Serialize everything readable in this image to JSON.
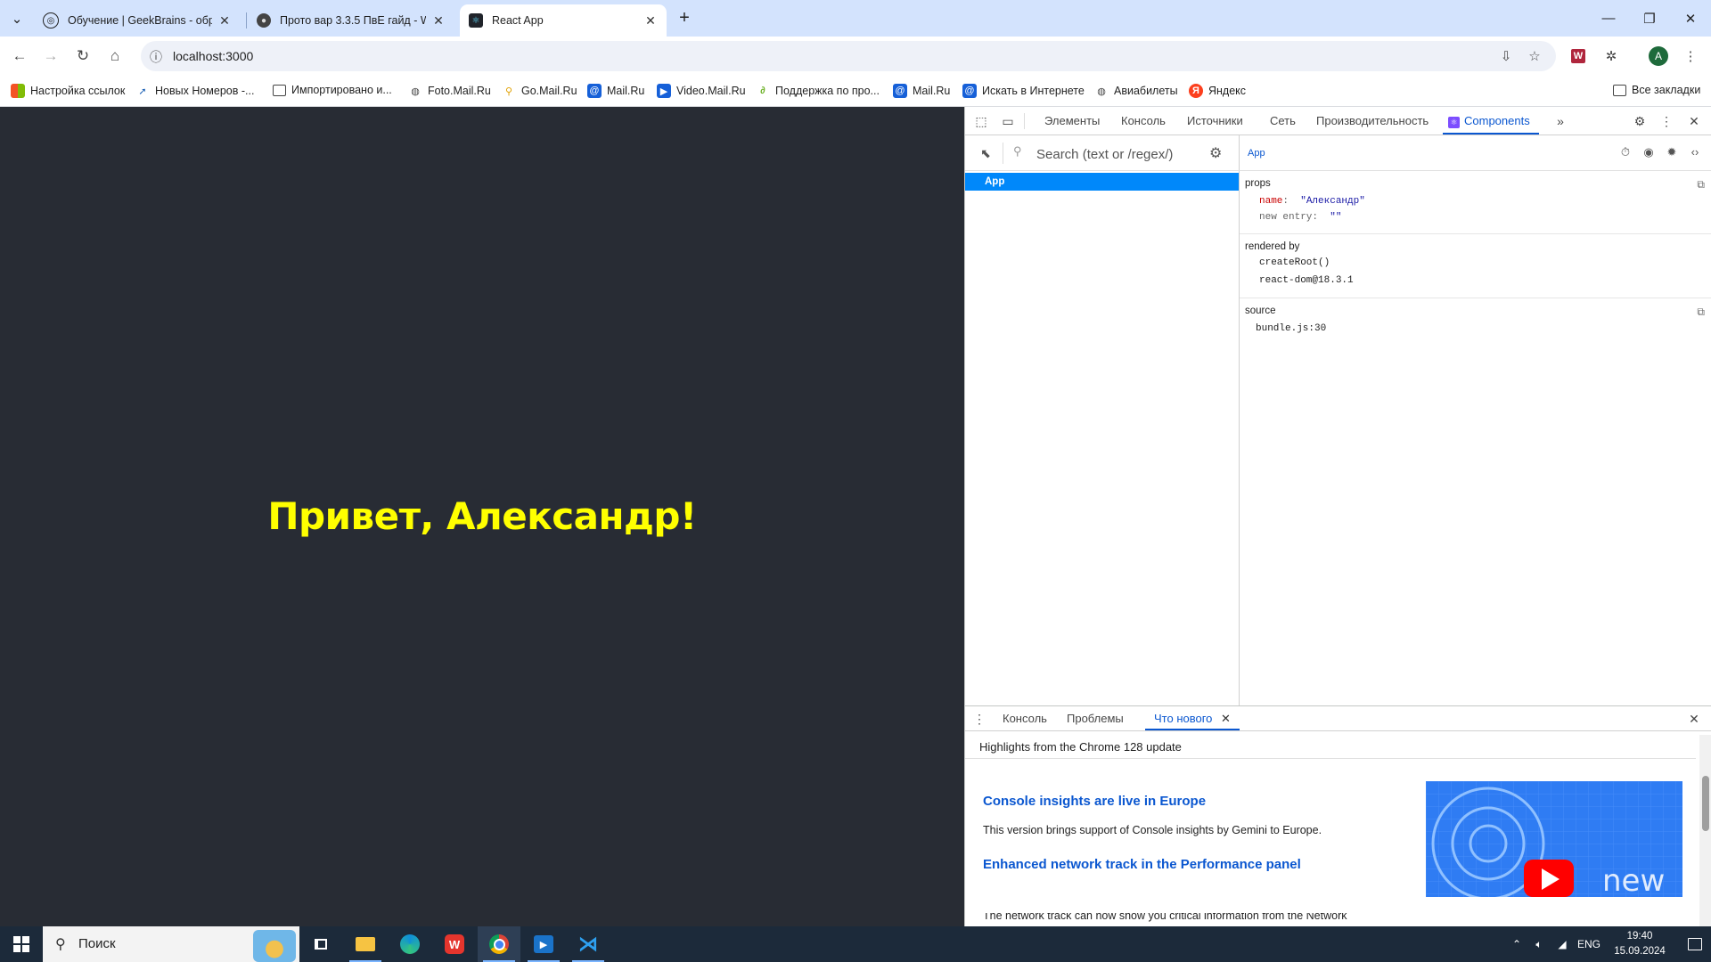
{
  "browser": {
    "tabs": [
      {
        "title": "Обучение | GeekBrains - обра",
        "icon": "geekbrains-icon",
        "active": false
      },
      {
        "title": "Прото вар 3.3.5 ПвЕ гайд - Wo",
        "icon": "wowcircle-icon",
        "active": false
      },
      {
        "title": "React App",
        "icon": "react-icon",
        "active": true
      }
    ],
    "url": "localhost:3000",
    "profile_initial": "A",
    "bookmarks": [
      {
        "label": "Настройка ссылок",
        "icon": "windows-icon"
      },
      {
        "label": "Новых Номеров -...",
        "icon": "arrow-icon"
      },
      {
        "label": "Импортировано и...",
        "icon": "folder-icon"
      },
      {
        "label": "Foto.Mail.Ru",
        "icon": "globe-icon"
      },
      {
        "label": "Go.Mail.Ru",
        "icon": "go-mail-icon"
      },
      {
        "label": "Mail.Ru",
        "icon": "mail-icon"
      },
      {
        "label": "Video.Mail.Ru",
        "icon": "video-mail-icon"
      },
      {
        "label": "Поддержка по про...",
        "icon": "support-icon"
      },
      {
        "label": "Mail.Ru",
        "icon": "mail-icon"
      },
      {
        "label": "Искать в Интернете",
        "icon": "mail-icon"
      },
      {
        "label": "Авиабилеты",
        "icon": "globe-icon"
      },
      {
        "label": "Яндекс",
        "icon": "yandex-icon"
      }
    ],
    "all_bookmarks": "Все закладки"
  },
  "page": {
    "greeting": "Привет, Александр!"
  },
  "devtools": {
    "tabs": [
      "Элементы",
      "Консоль",
      "Источники",
      "Сеть",
      "Производительность",
      "Components"
    ],
    "active_tab": "Components",
    "search_placeholder": "Search (text or /regex/)",
    "tree": [
      "App"
    ],
    "inspector": {
      "component": "App",
      "props_title": "props",
      "props": [
        {
          "key": "name",
          "sep": ":",
          "value": "\"Александр\""
        },
        {
          "key": "new entry",
          "sep": ":",
          "value": "\"\""
        }
      ],
      "rendered_by_title": "rendered by",
      "rendered_by": [
        "createRoot()",
        "react-dom@18.3.1"
      ],
      "source_title": "source",
      "source": "bundle.js:30"
    },
    "drawer": {
      "tabs": [
        "Консоль",
        "Проблемы",
        "Что нового"
      ],
      "active_tab": "Что нового",
      "header": "Highlights from the Chrome 128 update",
      "items": [
        {
          "title": "Console insights are live in Europe",
          "text": "This version brings support of Console insights by Gemini to Europe."
        },
        {
          "title": "Enhanced network track in the Performance panel",
          "text": "The network track can now show you critical information from the Network"
        }
      ],
      "image_text": "new"
    }
  },
  "taskbar": {
    "search_label": "Поиск",
    "language": "ENG",
    "time": "19:40",
    "date": "15.09.2024"
  },
  "colors": {
    "page_bg": "#282c34",
    "greeting": "#ffff00",
    "accent": "#0b57d0",
    "react_selection": "#0088fa",
    "tabstrip": "#d3e3fd"
  }
}
